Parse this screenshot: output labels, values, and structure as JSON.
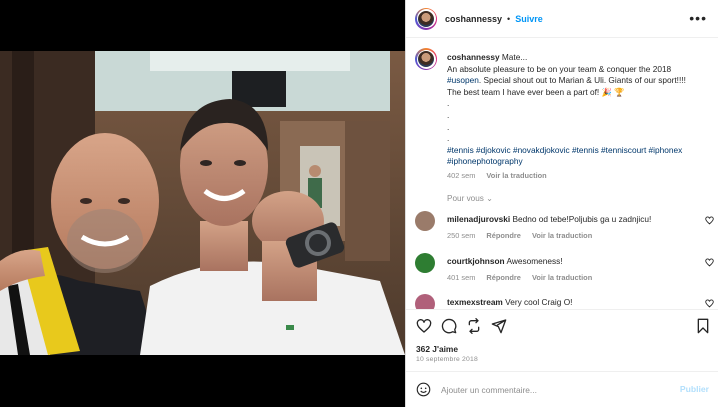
{
  "post": {
    "username": "coshannessy",
    "follow_label": "Suivre",
    "more_label": "•••",
    "caption": {
      "username": "coshannessy",
      "text_1": "Mate...",
      "text_2": "An absolute pleasure to be on your team & conquer the 2018",
      "tag_usopen": "#usopen",
      "text_3": ". Special shout out to Marian & Uli. Giants of our sport!!!!",
      "text_4": "The best team I have ever been a part of! 🎉 🏆",
      "dots": [
        ".",
        ".",
        ".",
        "."
      ],
      "hashtags": "#tennis #djokovic #novakdjokovic #tennis #tenniscourt #iphonex #iphonephotography",
      "time": "402 sem",
      "translate": "Voir la traduction"
    },
    "replies_toggle": "Pour vous ⌄",
    "comments": [
      {
        "user": "milenadjurovski",
        "text": "Bedno od tebe!Poljubis ga u zadnjicu!",
        "time": "250 sem",
        "reply": "Répondre",
        "translate": "Voir la traduction",
        "avatar_color": "#9a7b6a"
      },
      {
        "user": "courtkjohnson",
        "text": "Awesomeness!",
        "time": "401 sem",
        "reply": "Répondre",
        "translate": "Voir la traduction",
        "avatar_color": "#2e7d32"
      },
      {
        "user": "texmexstream",
        "text": "Very cool Craig O!",
        "time": "",
        "reply": "",
        "translate": "",
        "avatar_color": "#b0607a"
      }
    ],
    "likes": "362 J'aime",
    "date": "10 septembre 2018",
    "add_comment_placeholder": "Ajouter un commentaire...",
    "publish_label": "Publier"
  },
  "icons": {
    "like": "heart-icon",
    "comment": "comment-icon",
    "share": "share-icon",
    "send": "send-icon",
    "save": "bookmark-icon",
    "emoji": "emoji-icon"
  },
  "colors": {
    "accent": "#0095f6",
    "link": "#00376b",
    "muted": "#8e8e8e",
    "publish_disabled": "#b2dffc"
  }
}
